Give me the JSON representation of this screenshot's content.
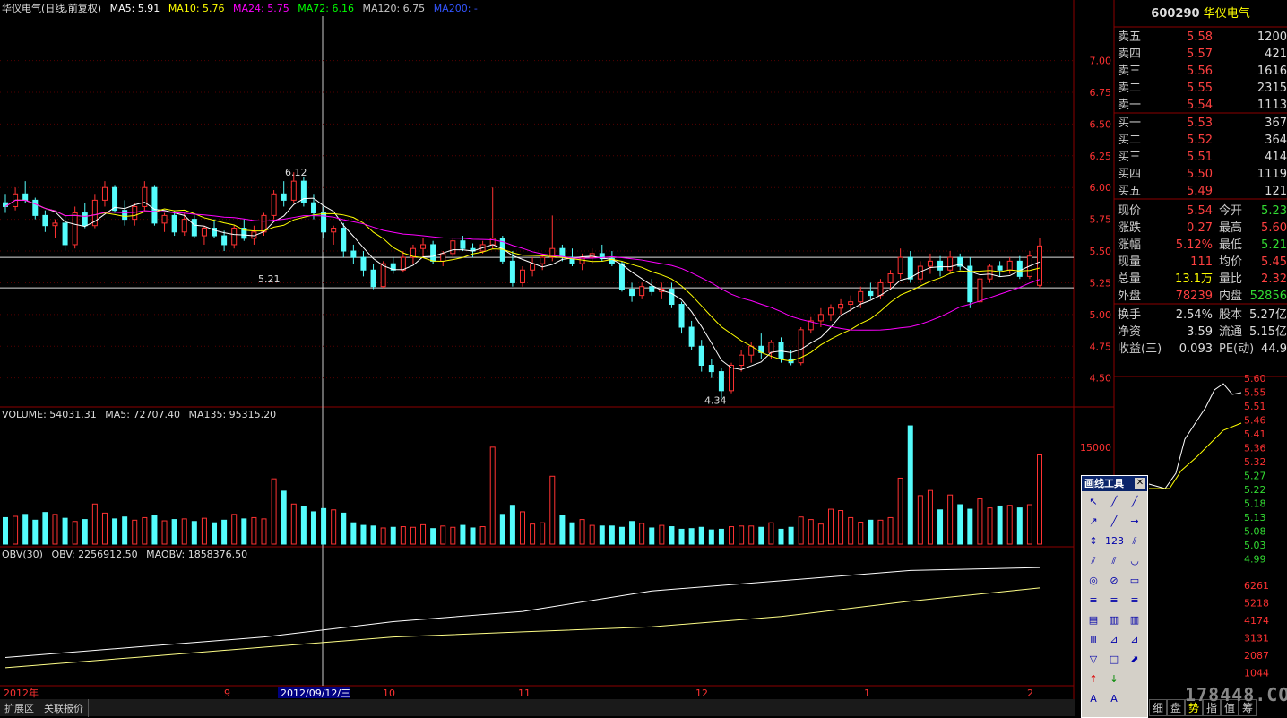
{
  "main_header": {
    "name": "华仪电气(日线,前复权)",
    "ma5": "MA5: 5.91",
    "ma10": "MA10: 5.76",
    "ma24": "MA24: 5.75",
    "ma72": "MA72: 6.16",
    "ma120": "MA120: 6.75",
    "ma200": "MA200: -"
  },
  "volume_header": {
    "label": "VOLUME: 54031.31",
    "ma5": "MA5: 72707.40",
    "ma135": "MA135: 95315.20"
  },
  "obv_header": {
    "label": "OBV(30)",
    "obv": "OBV: 2256912.50",
    "maobv": "MAOBV: 1858376.50"
  },
  "x_axis": {
    "year": "2012年",
    "months": [
      "9",
      "10",
      "11",
      "12",
      "1",
      "2"
    ],
    "cursor_date": "2012/09/12/三"
  },
  "annotations": {
    "high": "6.12",
    "low": "4.34",
    "support": "5.21"
  },
  "quote": {
    "code": "600290",
    "name": "华仪电气",
    "asks": [
      {
        "label": "卖五",
        "price": "5.58",
        "vol": "1200"
      },
      {
        "label": "卖四",
        "price": "5.57",
        "vol": "421"
      },
      {
        "label": "卖三",
        "price": "5.56",
        "vol": "1616"
      },
      {
        "label": "卖二",
        "price": "5.55",
        "vol": "2315"
      },
      {
        "label": "卖一",
        "price": "5.54",
        "vol": "1113"
      }
    ],
    "bids": [
      {
        "label": "买一",
        "price": "5.53",
        "vol": "367"
      },
      {
        "label": "买二",
        "price": "5.52",
        "vol": "364"
      },
      {
        "label": "买三",
        "price": "5.51",
        "vol": "414"
      },
      {
        "label": "买四",
        "price": "5.50",
        "vol": "1119"
      },
      {
        "label": "买五",
        "price": "5.49",
        "vol": "121"
      }
    ],
    "stats": [
      {
        "l1": "现价",
        "v1": "5.54",
        "l2": "今开",
        "v2": "5.23"
      },
      {
        "l1": "涨跌",
        "v1": "0.27",
        "l2": "最高",
        "v2": "5.60"
      },
      {
        "l1": "涨幅",
        "v1": "5.12%",
        "l2": "最低",
        "v2": "5.21"
      },
      {
        "l1": "现量",
        "v1": "111",
        "l2": "均价",
        "v2": "5.45"
      },
      {
        "l1": "总量",
        "v1": "13.1万",
        "l2": "量比",
        "v2": "2.32"
      },
      {
        "l1": "外盘",
        "v1": "78239",
        "l2": "内盘",
        "v2": "52856"
      }
    ],
    "fund": [
      {
        "l1": "换手",
        "v1": "2.54%",
        "l2": "股本",
        "v2": "5.27亿"
      },
      {
        "l1": "净资",
        "v1": "3.59",
        "l2": "流通",
        "v2": "5.15亿"
      },
      {
        "l1": "收益(三)",
        "v1": "0.093",
        "l2": "PE(动)",
        "v2": "44.9"
      }
    ]
  },
  "intraday_axis": [
    "5.60",
    "5.55",
    "5.51",
    "5.46",
    "5.41",
    "5.36",
    "5.32",
    "5.27",
    "5.22",
    "5.18",
    "5.13",
    "5.08",
    "5.03",
    "4.99"
  ],
  "intraday_vol_axis": [
    "6261",
    "5218",
    "4174",
    "3131",
    "2087",
    "1044"
  ],
  "tools": {
    "title": "画线工具",
    "close": "✕"
  },
  "bottom_bar": [
    "扩展区",
    "关联报价"
  ],
  "tabs": [
    "细",
    "盘",
    "势",
    "指",
    "值",
    "筹"
  ],
  "watermark": "178448.COM",
  "colors": {
    "up": "#ff3232",
    "down": "#54fcfc",
    "ma5": "#ffffff",
    "ma10": "#ffff00",
    "ma24": "#ff00ff",
    "ma72": "#00ff00",
    "ma120": "#c8c8c8",
    "ma200": "#0000ff"
  },
  "chart_data": [
    {
      "type": "candlestick",
      "title": "华仪电气(日线,前复权)",
      "y_ticks": [
        7.0,
        6.75,
        6.5,
        6.25,
        6.0,
        5.75,
        5.5,
        5.25,
        5.0,
        4.75,
        4.5
      ],
      "ylim": [
        4.3,
        7.35
      ],
      "x_months": [
        "9",
        "10",
        "11",
        "12",
        "1",
        "2"
      ],
      "candles": [
        [
          5.88,
          5.95,
          5.8,
          5.85
        ],
        [
          5.85,
          6.0,
          5.82,
          5.95
        ],
        [
          5.95,
          6.05,
          5.88,
          5.9
        ],
        [
          5.9,
          5.92,
          5.75,
          5.78
        ],
        [
          5.78,
          5.82,
          5.65,
          5.7
        ],
        [
          5.7,
          5.75,
          5.6,
          5.72
        ],
        [
          5.72,
          5.78,
          5.5,
          5.55
        ],
        [
          5.55,
          5.85,
          5.52,
          5.8
        ],
        [
          5.8,
          5.88,
          5.68,
          5.7
        ],
        [
          5.7,
          5.95,
          5.68,
          5.9
        ],
        [
          5.9,
          6.05,
          5.85,
          6.0
        ],
        [
          6.0,
          6.02,
          5.8,
          5.82
        ],
        [
          5.82,
          5.9,
          5.7,
          5.75
        ],
        [
          5.75,
          5.88,
          5.7,
          5.85
        ],
        [
          5.85,
          6.05,
          5.82,
          6.0
        ],
        [
          6.0,
          6.02,
          5.7,
          5.72
        ],
        [
          5.72,
          5.8,
          5.65,
          5.78
        ],
        [
          5.78,
          5.82,
          5.62,
          5.65
        ],
        [
          5.65,
          5.8,
          5.62,
          5.75
        ],
        [
          5.75,
          5.78,
          5.6,
          5.62
        ],
        [
          5.62,
          5.7,
          5.55,
          5.68
        ],
        [
          5.68,
          5.75,
          5.6,
          5.62
        ],
        [
          5.62,
          5.66,
          5.5,
          5.55
        ],
        [
          5.55,
          5.7,
          5.52,
          5.68
        ],
        [
          5.68,
          5.75,
          5.58,
          5.6
        ],
        [
          5.6,
          5.7,
          5.55,
          5.65
        ],
        [
          5.65,
          5.8,
          5.62,
          5.78
        ],
        [
          5.78,
          5.98,
          5.75,
          5.95
        ],
        [
          5.95,
          6.05,
          5.85,
          5.9
        ],
        [
          5.9,
          6.12,
          5.88,
          6.05
        ],
        [
          6.05,
          6.08,
          5.85,
          5.88
        ],
        [
          5.88,
          5.95,
          5.75,
          5.8
        ],
        [
          5.8,
          5.85,
          5.6,
          5.65
        ],
        [
          5.65,
          5.7,
          5.55,
          5.68
        ],
        [
          5.68,
          5.72,
          5.45,
          5.5
        ],
        [
          5.5,
          5.55,
          5.4,
          5.45
        ],
        [
          5.45,
          5.5,
          5.3,
          5.35
        ],
        [
          5.35,
          5.4,
          5.2,
          5.22
        ],
        [
          5.22,
          5.42,
          5.21,
          5.4
        ],
        [
          5.4,
          5.45,
          5.32,
          5.35
        ],
        [
          5.35,
          5.5,
          5.33,
          5.45
        ],
        [
          5.45,
          5.55,
          5.4,
          5.52
        ],
        [
          5.52,
          5.6,
          5.45,
          5.55
        ],
        [
          5.55,
          5.58,
          5.4,
          5.42
        ],
        [
          5.42,
          5.5,
          5.38,
          5.48
        ],
        [
          5.48,
          5.6,
          5.45,
          5.58
        ],
        [
          5.58,
          5.62,
          5.5,
          5.52
        ],
        [
          5.52,
          5.56,
          5.45,
          5.5
        ],
        [
          5.5,
          5.58,
          5.48,
          5.55
        ],
        [
          5.55,
          6.0,
          5.52,
          5.6
        ],
        [
          5.6,
          5.62,
          5.4,
          5.42
        ],
        [
          5.42,
          5.5,
          5.22,
          5.25
        ],
        [
          5.25,
          5.38,
          5.22,
          5.35
        ],
        [
          5.35,
          5.45,
          5.3,
          5.4
        ],
        [
          5.4,
          5.48,
          5.35,
          5.45
        ],
        [
          5.45,
          5.78,
          5.42,
          5.52
        ],
        [
          5.52,
          5.55,
          5.42,
          5.45
        ],
        [
          5.45,
          5.52,
          5.38,
          5.4
        ],
        [
          5.4,
          5.48,
          5.35,
          5.45
        ],
        [
          5.45,
          5.52,
          5.4,
          5.48
        ],
        [
          5.48,
          5.55,
          5.42,
          5.44
        ],
        [
          5.44,
          5.5,
          5.38,
          5.4
        ],
        [
          5.4,
          5.42,
          5.18,
          5.2
        ],
        [
          5.2,
          5.25,
          5.1,
          5.15
        ],
        [
          5.15,
          5.25,
          5.12,
          5.22
        ],
        [
          5.22,
          5.28,
          5.15,
          5.18
        ],
        [
          5.18,
          5.25,
          5.12,
          5.2
        ],
        [
          5.2,
          5.25,
          5.05,
          5.08
        ],
        [
          5.08,
          5.1,
          4.85,
          4.9
        ],
        [
          4.9,
          4.95,
          4.72,
          4.75
        ],
        [
          4.75,
          4.8,
          4.55,
          4.6
        ],
        [
          4.6,
          4.65,
          4.5,
          4.55
        ],
        [
          4.55,
          4.58,
          4.34,
          4.4
        ],
        [
          4.4,
          4.62,
          4.38,
          4.6
        ],
        [
          4.6,
          4.72,
          4.55,
          4.68
        ],
        [
          4.68,
          4.78,
          4.62,
          4.75
        ],
        [
          4.75,
          4.85,
          4.65,
          4.7
        ],
        [
          4.7,
          4.8,
          4.65,
          4.78
        ],
        [
          4.78,
          4.82,
          4.62,
          4.65
        ],
        [
          4.65,
          4.72,
          4.6,
          4.62
        ],
        [
          4.62,
          4.9,
          4.6,
          4.88
        ],
        [
          4.88,
          4.98,
          4.85,
          4.95
        ],
        [
          4.95,
          5.05,
          4.9,
          5.0
        ],
        [
          5.0,
          5.08,
          4.95,
          5.05
        ],
        [
          5.05,
          5.12,
          5.0,
          5.08
        ],
        [
          5.08,
          5.15,
          5.02,
          5.1
        ],
        [
          5.1,
          5.22,
          5.05,
          5.18
        ],
        [
          5.18,
          5.25,
          5.12,
          5.15
        ],
        [
          5.15,
          5.28,
          5.12,
          5.25
        ],
        [
          5.25,
          5.35,
          5.2,
          5.32
        ],
        [
          5.32,
          5.52,
          5.28,
          5.45
        ],
        [
          5.45,
          5.5,
          5.25,
          5.28
        ],
        [
          5.28,
          5.42,
          5.25,
          5.38
        ],
        [
          5.38,
          5.48,
          5.32,
          5.42
        ],
        [
          5.42,
          5.46,
          5.3,
          5.35
        ],
        [
          5.35,
          5.5,
          5.32,
          5.45
        ],
        [
          5.45,
          5.48,
          5.35,
          5.38
        ],
        [
          5.38,
          5.45,
          5.05,
          5.1
        ],
        [
          5.1,
          5.3,
          5.08,
          5.28
        ],
        [
          5.28,
          5.4,
          5.25,
          5.38
        ],
        [
          5.38,
          5.42,
          5.3,
          5.35
        ],
        [
          5.35,
          5.45,
          5.32,
          5.42
        ],
        [
          5.42,
          5.46,
          5.28,
          5.3
        ],
        [
          5.3,
          5.5,
          5.28,
          5.46
        ],
        [
          5.23,
          5.6,
          5.21,
          5.54
        ]
      ],
      "horizontal_lines": [
        5.45,
        5.21
      ]
    },
    {
      "type": "bar",
      "title": "VOLUME",
      "y_ticks": [
        15000
      ],
      "values": [
        4100,
        4300,
        4600,
        3700,
        4900,
        4600,
        4000,
        3500,
        3800,
        6200,
        4800,
        3900,
        4200,
        3700,
        4100,
        4400,
        3600,
        3800,
        3900,
        3500,
        4000,
        3300,
        3700,
        4600,
        3900,
        4100,
        3900,
        10100,
        8200,
        6200,
        5800,
        5000,
        5500,
        5300,
        4800,
        3300,
        2900,
        2800,
        2500,
        2600,
        2700,
        2600,
        3000,
        2400,
        2800,
        2600,
        2900,
        2500,
        2700,
        15000,
        4600,
        6000,
        5000,
        3100,
        3300,
        10500,
        4400,
        3300,
        3800,
        2900,
        2800,
        2800,
        2600,
        3500,
        3200,
        2500,
        2900,
        2700,
        2300,
        2400,
        2600,
        2200,
        2300,
        2700,
        2800,
        2800,
        2600,
        3300,
        2300,
        2600,
        4200,
        3800,
        3100,
        5400,
        5200,
        4100,
        3400,
        3700,
        3700,
        4100,
        10200,
        18300,
        7500,
        8300,
        5300,
        7600,
        6100,
        5400,
        7000,
        5600,
        5900,
        6000,
        5600,
        6100,
        13800
      ]
    },
    {
      "type": "line",
      "title": "OBV(30)",
      "series": [
        {
          "name": "OBV",
          "values": [
            500000,
            700000,
            900000,
            1200000,
            1400000,
            1800000,
            2000000,
            2200000,
            2256912.5
          ]
        },
        {
          "name": "MAOBV",
          "values": [
            300000,
            500000,
            700000,
            900000,
            1000000,
            1100000,
            1300000,
            1600000,
            1858376.5
          ]
        }
      ]
    }
  ]
}
